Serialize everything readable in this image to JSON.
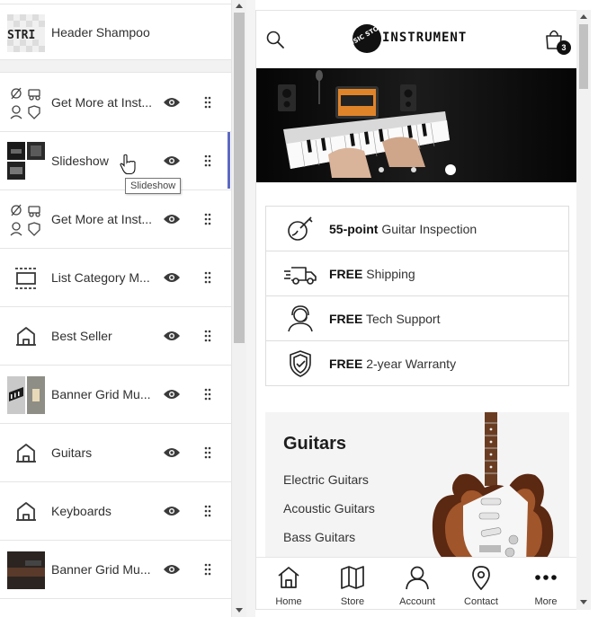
{
  "sections": {
    "header_label": "Header Shampoo",
    "items": [
      {
        "label": "Get More at Inst...",
        "thumb": "icons-grid"
      },
      {
        "label": "Slideshow",
        "thumb": "photos"
      },
      {
        "label": "Get More at Inst...",
        "thumb": "icons-grid"
      },
      {
        "label": "List Category M...",
        "thumb": "list-category-icon"
      },
      {
        "label": "Best Seller",
        "thumb": "house-icon"
      },
      {
        "label": "Banner Grid Mu...",
        "thumb": "photos"
      },
      {
        "label": "Guitars",
        "thumb": "house-icon"
      },
      {
        "label": "Keyboards",
        "thumb": "house-icon"
      },
      {
        "label": "Banner Grid Mu...",
        "thumb": "photo"
      }
    ],
    "tooltip": "Slideshow",
    "active_accent": "#5c6ac4"
  },
  "preview": {
    "logo_badge": "MUSIC STORE",
    "logo_text": "INSTRUMENT",
    "cart_count": "3",
    "slideshow": {
      "dots": 3,
      "active_dot": 3
    },
    "features": [
      {
        "bold": "55-point",
        "text": " Guitar Inspection",
        "icon": "guitar-inspection-icon"
      },
      {
        "bold": "FREE",
        "text": " Shipping",
        "icon": "truck-icon"
      },
      {
        "bold": "FREE",
        "text": " Tech Support",
        "icon": "headset-icon"
      },
      {
        "bold": "FREE",
        "text": " 2-year Warranty",
        "icon": "shield-check-icon"
      }
    ],
    "guitars": {
      "title": "Guitars",
      "links": [
        "Electric Guitars",
        "Acoustic Guitars",
        "Bass Guitars"
      ]
    },
    "nav": [
      {
        "label": "Home",
        "icon": "home-icon"
      },
      {
        "label": "Store",
        "icon": "map-icon"
      },
      {
        "label": "Account",
        "icon": "user-icon"
      },
      {
        "label": "Contact",
        "icon": "location-pin-icon"
      },
      {
        "label": "More",
        "icon": "more-dots-icon"
      }
    ]
  }
}
